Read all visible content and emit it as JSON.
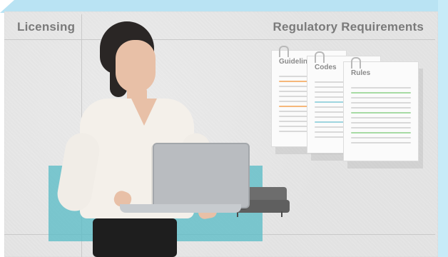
{
  "labels": {
    "left": "Licensing",
    "right": "Regulatory Requirements"
  },
  "documents": [
    {
      "title": "Guidelines"
    },
    {
      "title": "Codes"
    },
    {
      "title": "Rules"
    }
  ],
  "colors": {
    "frame_blue": "#b8e3f2",
    "wall": "#e3e3e3",
    "accent_teal": "#5bbcc6",
    "label_gray": "#7a7a7a"
  }
}
